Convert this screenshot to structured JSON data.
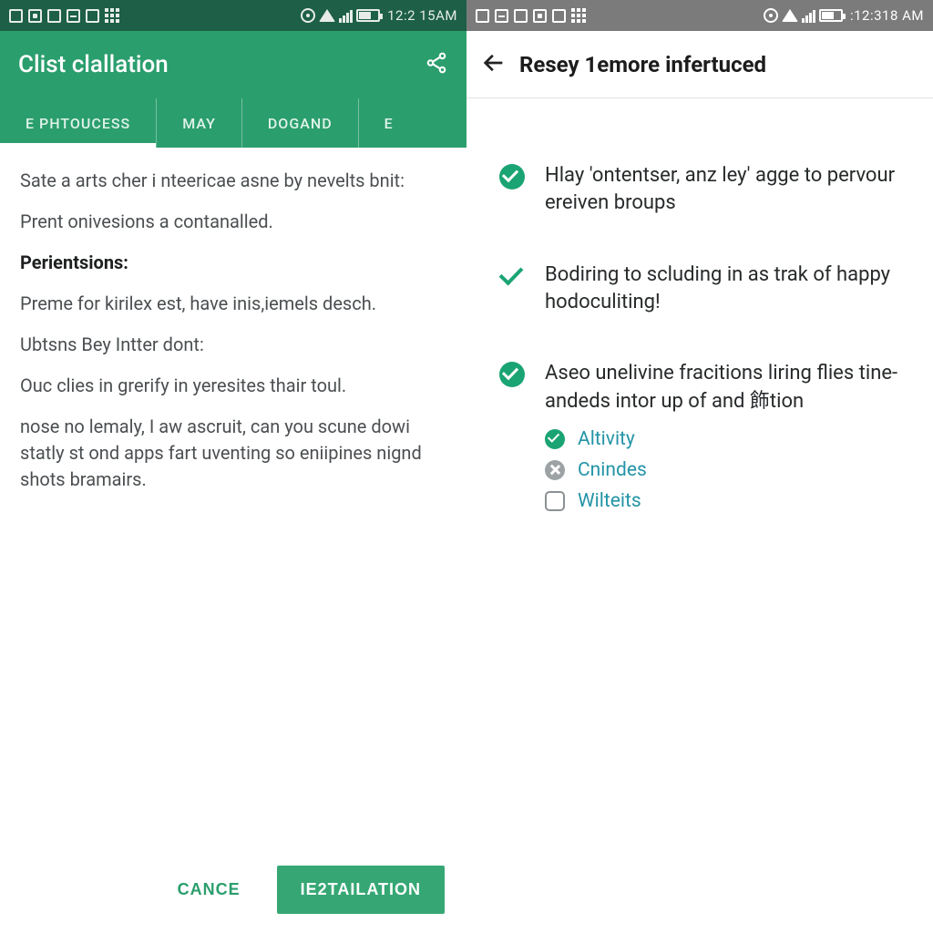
{
  "colors": {
    "primary": "#2b9e6d",
    "primaryDark": "#1d5f47",
    "teal": "#2494a7"
  },
  "left": {
    "statusbar": {
      "time": "12:2 15AM"
    },
    "appbar": {
      "title": "Clist clallation"
    },
    "tabs": [
      {
        "label": "E PHTOUCESS",
        "active": true
      },
      {
        "label": "MAY",
        "active": false
      },
      {
        "label": "DOGAND",
        "active": false
      },
      {
        "label": "E",
        "active": false
      }
    ],
    "body": {
      "p1": "Sate a arts cher i nteericae asne by nevelts bnit:",
      "p2": "Prent onivesions a contanalled.",
      "h1": "Perientsions:",
      "p3": "Preme for kirilex est, have inis,iemels desch.",
      "p4": "Ubtsns Bey Intter dont:",
      "p5": "Ouc clies in grerify in yeresites thair toul.",
      "p6": "nose no lemaly, I aw ascruit, can you scune dowi statly st ond apps fart uventing so eniipines nignd shots bramairs."
    },
    "footer": {
      "cancel": "CANCE",
      "primary": "IE2TAILATION"
    }
  },
  "right": {
    "statusbar": {
      "time": ":12:318 AM"
    },
    "appbar": {
      "title": "Resey 1emore infertuced"
    },
    "items": [
      {
        "icon": "check-filled",
        "text": "Hlay 'ontentser, anz ley' agge to pervour ereiven broups"
      },
      {
        "icon": "check-outline",
        "text": "Bodiring to scluding in as trak of happy hodoculiting!"
      },
      {
        "icon": "check-filled",
        "text": "Aseo unelivine fracitions liring flies tine-andeds intor up of and 飾tion",
        "sub": [
          {
            "icon": "check",
            "label": "Altivity"
          },
          {
            "icon": "cross",
            "label": "Cnindes"
          },
          {
            "icon": "empty",
            "label": "Wilteits"
          }
        ]
      }
    ]
  }
}
